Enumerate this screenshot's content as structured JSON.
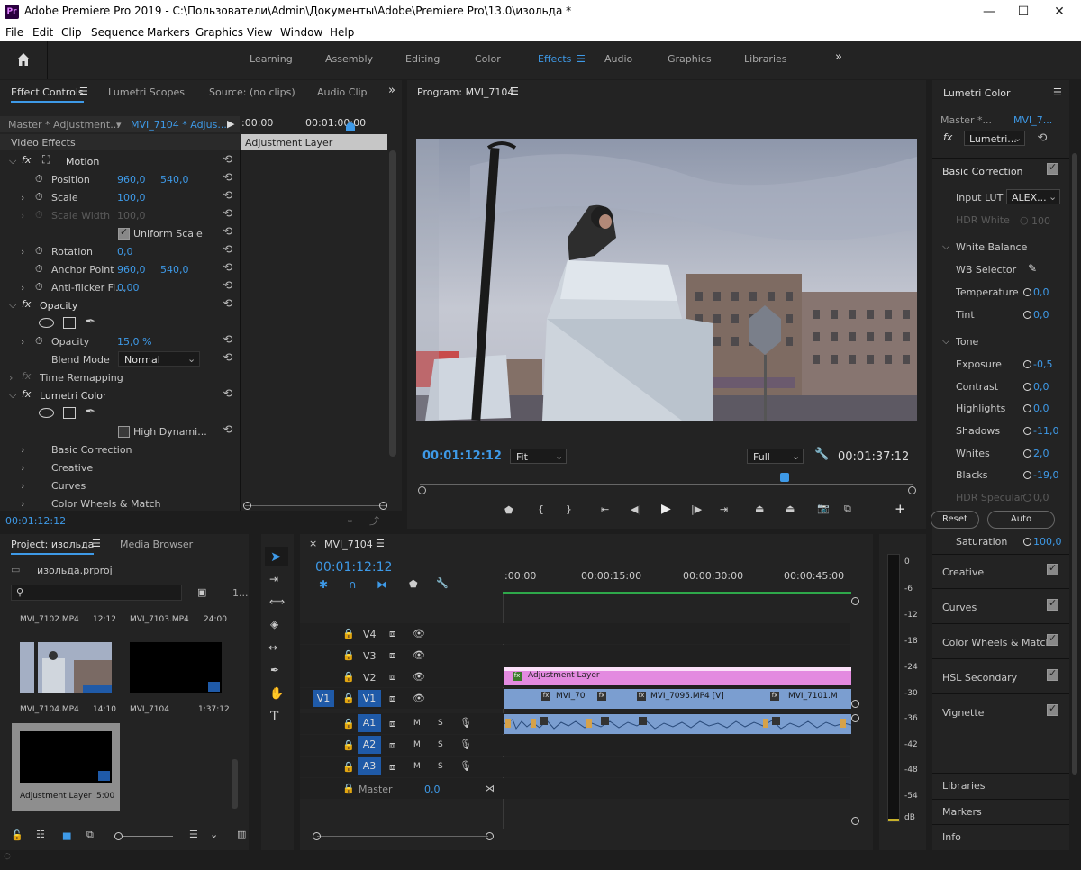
{
  "window": {
    "app_logo": "Pr",
    "title": "Adobe Premiere Pro 2019 - C:\\Пользователи\\Admin\\Документы\\Adobe\\Premiere Pro\\13.0\\изольда *"
  },
  "menu": [
    "File",
    "Edit",
    "Clip",
    "Sequence",
    "Markers",
    "Graphics",
    "View",
    "Window",
    "Help"
  ],
  "workspaces": [
    "Learning",
    "Assembly",
    "Editing",
    "Color",
    "Effects",
    "Audio",
    "Graphics",
    "Libraries"
  ],
  "active_workspace": "Effects",
  "left_tabs": [
    "Effect Controls",
    "Lumetri Scopes",
    "Source: (no clips)",
    "Audio Clip M"
  ],
  "effect_controls": {
    "master_label": "Master * Adjustment...",
    "clip_label": "MVI_7104 * Adjus...",
    "ruler_start": ":00:00",
    "ruler_mid": "00:01:00:00",
    "clip_bar": "Adjustment Layer",
    "section": "Video Effects",
    "motion": "Motion",
    "position_label": "Position",
    "position_x": "960,0",
    "position_y": "540,0",
    "scale_label": "Scale",
    "scale_value": "100,0",
    "scale_width_label": "Scale Width",
    "scale_width_value": "100,0",
    "uniform_scale": "Uniform Scale",
    "rotation_label": "Rotation",
    "rotation_value": "0,0",
    "anchor_label": "Anchor Point",
    "anchor_x": "960,0",
    "anchor_y": "540,0",
    "antiflicker_label": "Anti-flicker Fi...",
    "antiflicker_value": "0,00",
    "opacity_section": "Opacity",
    "opacity_label": "Opacity",
    "opacity_value": "15,0 %",
    "blend_label": "Blend Mode",
    "blend_value": "Normal",
    "time_remap": "Time Remapping",
    "lumetri": "Lumetri Color",
    "high_dynamic": "High Dynami...",
    "basic_correction": "Basic Correction",
    "creative": "Creative",
    "curves": "Curves",
    "color_wheels": "Color Wheels & Match",
    "timecode": "00:01:12:12"
  },
  "program": {
    "tab": "Program: MVI_7104",
    "timecode": "00:01:12:12",
    "fit": "Fit",
    "full": "Full",
    "duration": "00:01:37:12"
  },
  "lumetri_panel": {
    "title": "Lumetri Color",
    "master": "Master *...",
    "clip": "MVI_7...",
    "effect": "Lumetri...",
    "basic_correction": "Basic Correction",
    "input_lut": "Input LUT",
    "input_lut_value": "ALEX...",
    "hdr_white": "HDR White",
    "hdr_white_value": "100",
    "white_balance": "White Balance",
    "wb_selector": "WB Selector",
    "temperature": "Temperature",
    "temperature_value": "0,0",
    "tint": "Tint",
    "tint_value": "0,0",
    "tone": "Tone",
    "exposure": "Exposure",
    "exposure_value": "-0,5",
    "contrast": "Contrast",
    "contrast_value": "0,0",
    "highlights": "Highlights",
    "highlights_value": "0,0",
    "shadows": "Shadows",
    "shadows_value": "-11,0",
    "whites": "Whites",
    "whites_value": "2,0",
    "blacks": "Blacks",
    "blacks_value": "-19,0",
    "hdr_specular": "HDR Specular",
    "hdr_specular_value": "0,0",
    "reset": "Reset",
    "auto": "Auto",
    "saturation": "Saturation",
    "saturation_value": "100,0",
    "sections": [
      "Creative",
      "Curves",
      "Color Wheels & Match",
      "HSL Secondary",
      "Vignette"
    ],
    "bottom_panels": [
      "Libraries",
      "Markers",
      "Info"
    ]
  },
  "project": {
    "tab": "Project: изольда",
    "media_browser": "Media Browser",
    "file": "изольда.prproj",
    "count": "1...",
    "items": [
      {
        "name": "MVI_7102.MP4",
        "dur": "12:12"
      },
      {
        "name": "MVI_7103.MP4",
        "dur": "24:00"
      },
      {
        "name": "MVI_7104.MP4",
        "dur": "14:10"
      },
      {
        "name": "MVI_7104",
        "dur": "1:37:12"
      },
      {
        "name": "Adjustment Layer",
        "dur": "5:00"
      }
    ]
  },
  "timeline": {
    "tab": "MVI_7104",
    "timecode": "00:01:12:12",
    "ruler": [
      ":00:00",
      "00:00:15:00",
      "00:00:30:00",
      "00:00:45:00"
    ],
    "tracks_video": [
      "V4",
      "V3",
      "V2",
      "V1"
    ],
    "tracks_audio": [
      "A1",
      "A2",
      "A3"
    ],
    "source_patch": "V1",
    "master": "Master",
    "master_value": "0,0",
    "clip_adjustment": "Adjustment Layer",
    "clips_v1": [
      "MVI_70",
      "MVI_7095.MP4 [V]",
      "MVI_7101.M"
    ],
    "m": "M",
    "s": "S"
  },
  "meter": [
    "0",
    "-6",
    "-12",
    "-18",
    "-24",
    "-30",
    "-36",
    "-42",
    "-48",
    "-54",
    "dB"
  ],
  "colors": {
    "accent": "#3e9ae8",
    "adjustment": "#e38ae0",
    "clip_blue": "#7b9ed0",
    "playhead": "#3e9ae8"
  }
}
